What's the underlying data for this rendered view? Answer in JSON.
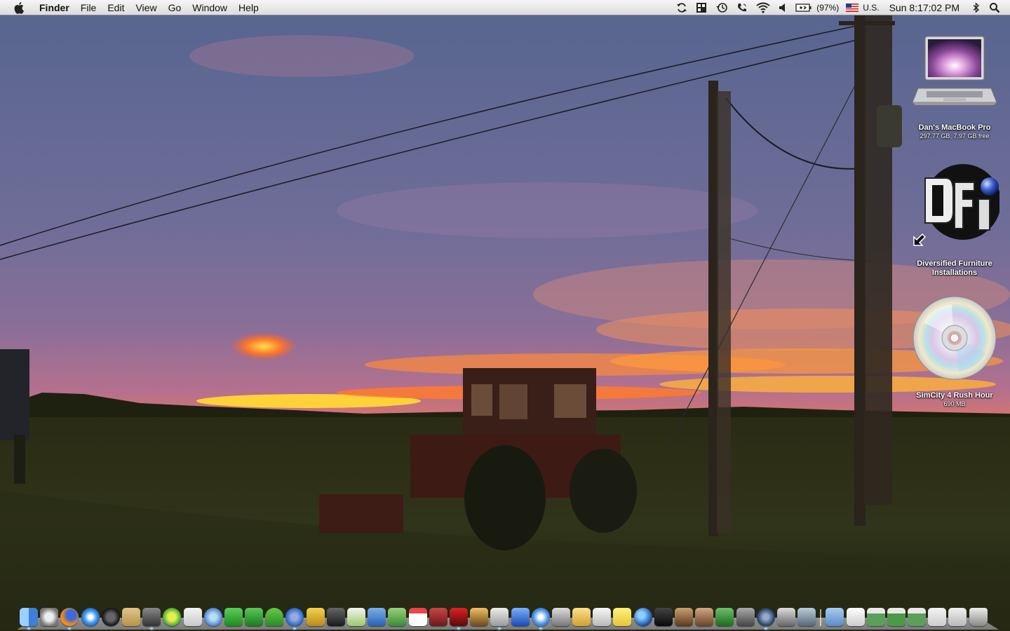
{
  "menubar": {
    "apple_icon": "apple-logo-icon",
    "app_name": "Finder",
    "menus": [
      "File",
      "Edit",
      "View",
      "Go",
      "Window",
      "Help"
    ],
    "status": {
      "sync_icon": "sync-icon",
      "spaces_icon": "spaces-icon",
      "time_machine_icon": "time-machine-icon",
      "phone_icon": "phone-icon",
      "wifi_icon": "wifi-icon",
      "volume_icon": "volume-icon",
      "battery_icon": "battery-icon",
      "battery_percent": "(97%)",
      "input_flag_icon": "us-flag-icon",
      "input_source": "U.S.",
      "clock": "Sun 8:17:02 PM",
      "bluetooth_icon": "bluetooth-icon",
      "spotlight_icon": "spotlight-search-icon"
    }
  },
  "desktop": {
    "icons": [
      {
        "name": "Dan's MacBook Pro",
        "detail": "297.77 GB, 7.97 GB free",
        "icon": "macbook-pro-drive-icon"
      },
      {
        "name": "Diversified Furniture Installations",
        "detail": "",
        "icon": "dfi-alias-icon"
      },
      {
        "name": "SimCity 4 Rush Hour",
        "detail": "690 MB",
        "icon": "cd-disc-icon"
      }
    ]
  },
  "colors": {
    "menubar_top": "#f6f6f6",
    "menubar_bottom": "#dcdcdc",
    "sky_top": "#5b6a93",
    "sunset_orange": "#ff6a2a",
    "sunset_yellow": "#ffd23a",
    "field": "#2b2e12"
  }
}
